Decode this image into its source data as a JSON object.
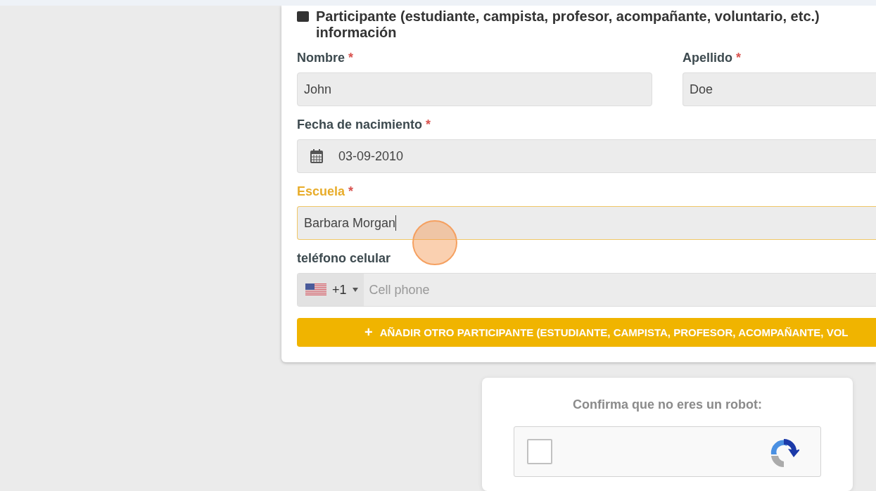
{
  "section": {
    "title": "Participante (estudiante, campista, profesor, acompañante, voluntario, etc.) información",
    "rows": [
      [
        {
          "kind": "text",
          "label": "Nombre",
          "required_mark": "*",
          "value": "John",
          "focused": false
        },
        {
          "kind": "text",
          "label": "Apellido",
          "required_mark": "*",
          "value": "Doe",
          "focused": false
        }
      ],
      [
        {
          "kind": "date",
          "label": "Fecha de nacimiento",
          "required_mark": "*",
          "value": "03-09-2010",
          "focused": false
        }
      ],
      [
        {
          "kind": "text",
          "label": "Escuela",
          "required_mark": "*",
          "value": "Barbara Morgan",
          "focused": true
        }
      ],
      [
        {
          "kind": "phone",
          "label": "teléfono celular",
          "dial_code": "+1",
          "placeholder": "Cell phone",
          "focused": false
        }
      ]
    ],
    "add_button": {
      "icon": "+",
      "label": "AÑADIR OTRO PARTICIPANTE (ESTUDIANTE, CAMPISTA, PROFESOR, ACOMPAÑANTE, VOL"
    }
  },
  "captcha": {
    "title": "Confirma que no eres un robot:",
    "checked": false
  }
}
